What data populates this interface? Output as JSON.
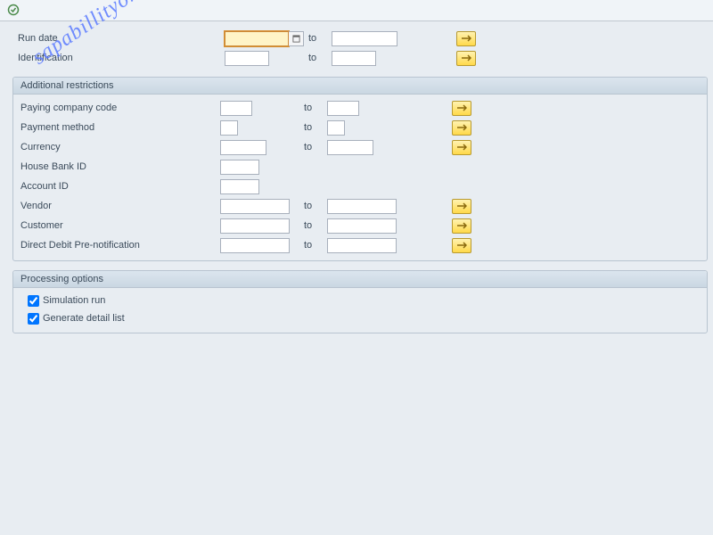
{
  "watermark": "sapabillityonline.com",
  "top": {
    "run_date_label": "Run date",
    "identification_label": "Identification",
    "to": "to"
  },
  "group1": {
    "title": "Additional restrictions",
    "rows": {
      "paying_company": "Paying company code",
      "payment_method": "Payment method",
      "currency": "Currency",
      "house_bank": "House Bank ID",
      "account_id": "Account ID",
      "vendor": "Vendor",
      "customer": "Customer",
      "direct_debit": "Direct Debit Pre-notification"
    },
    "to": "to"
  },
  "group2": {
    "title": "Processing options",
    "chk_sim": "Simulation run",
    "chk_detail": "Generate detail list"
  }
}
